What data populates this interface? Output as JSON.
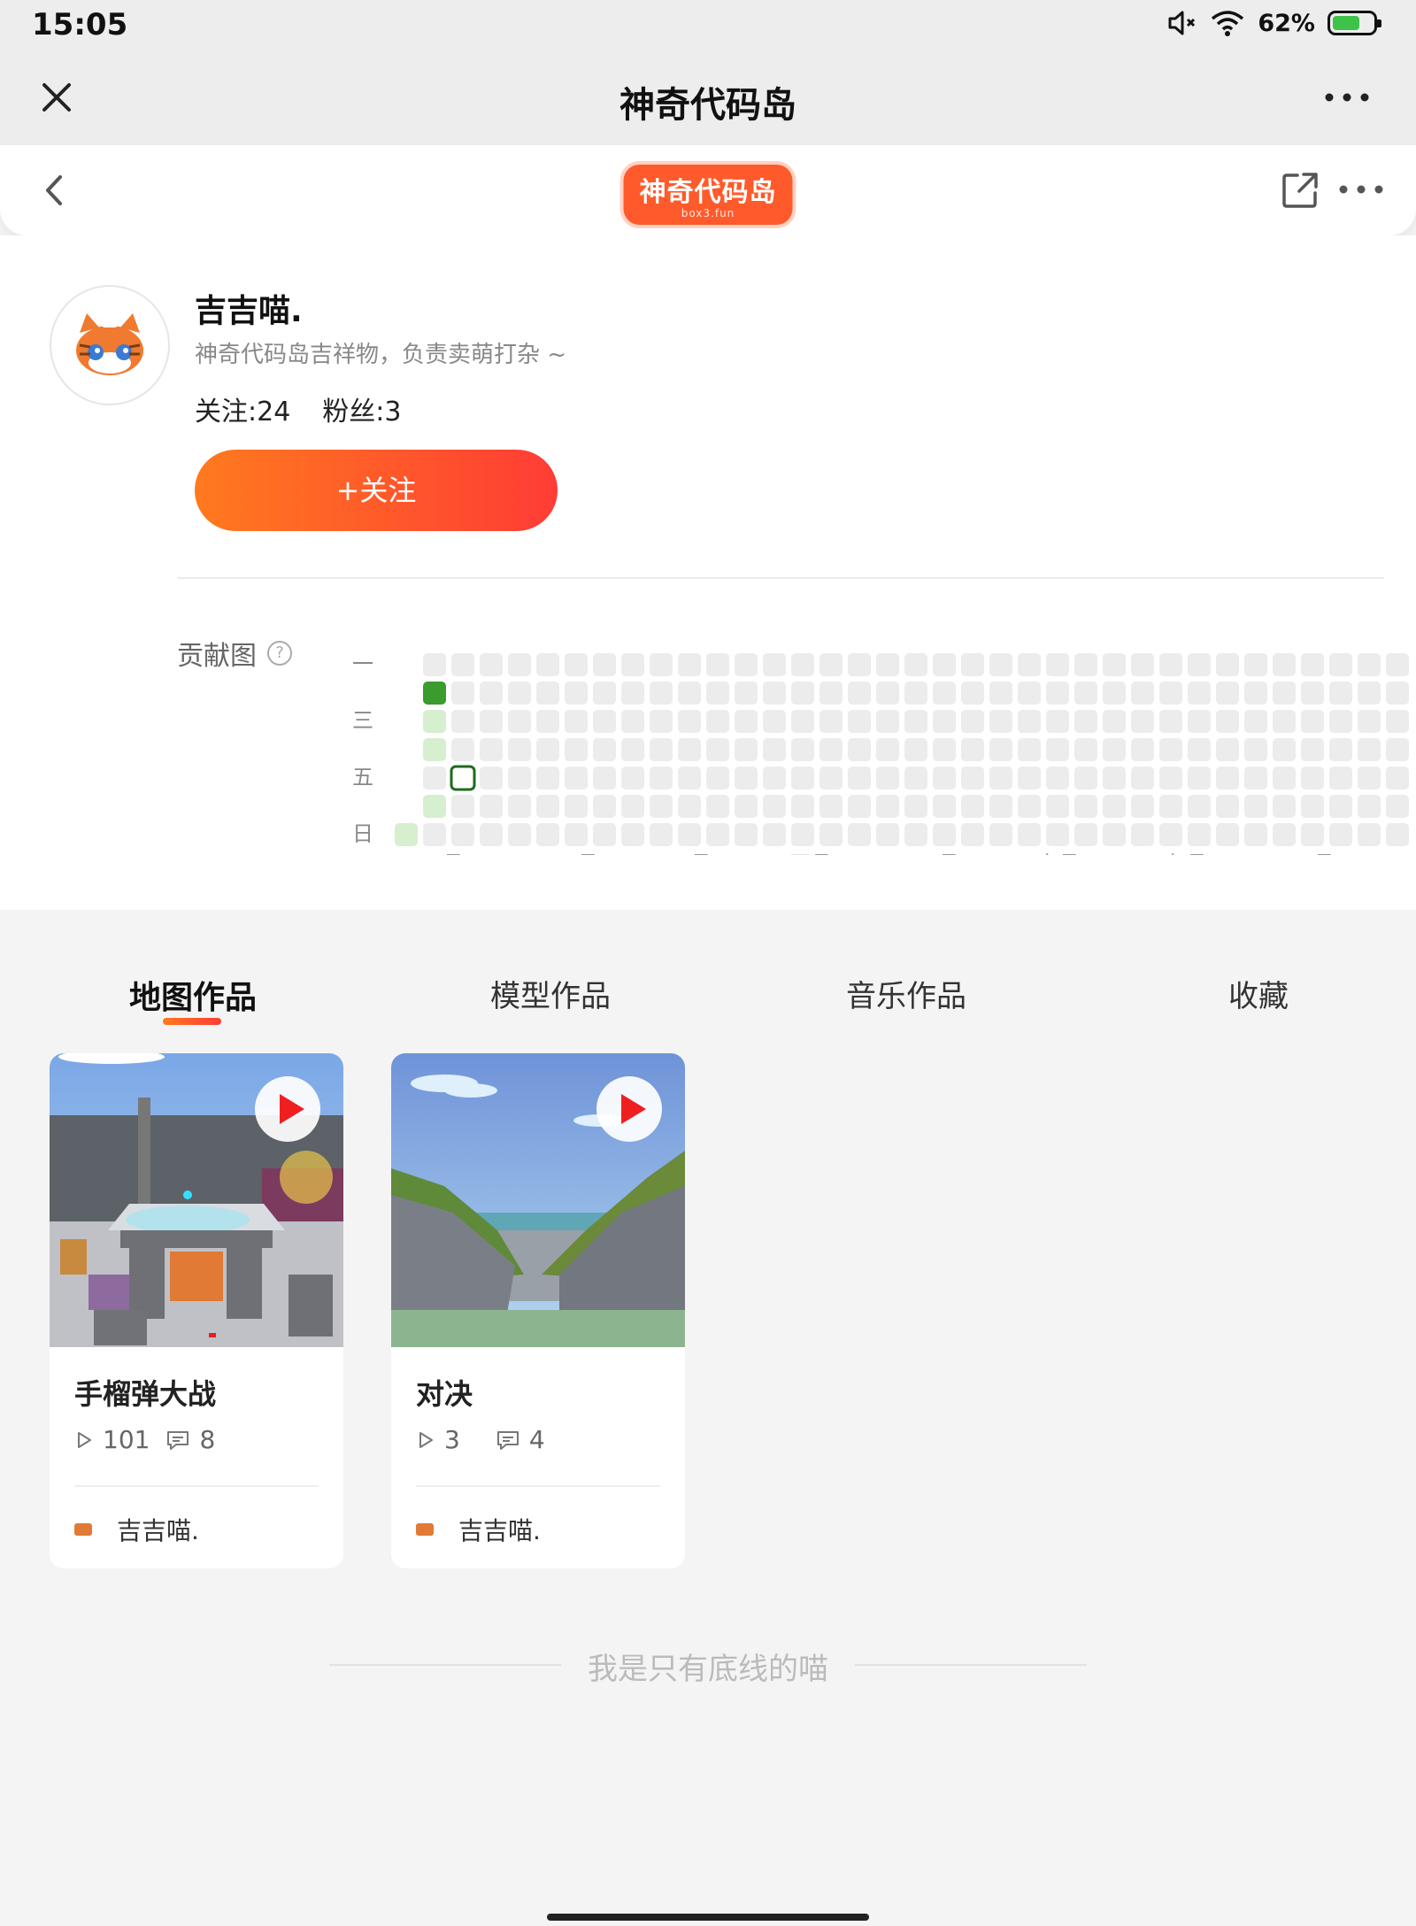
{
  "status": {
    "time": "15:05",
    "battery": "62%"
  },
  "app_bar": {
    "title": "神奇代码岛"
  },
  "site": {
    "logo_text": "神奇代码岛",
    "logo_sub": "box3.fun"
  },
  "profile": {
    "name": "吉吉喵.",
    "bio": "神奇代码岛吉祥物，负责卖萌打杂 ~",
    "following": "关注:24",
    "followers": "粉丝:3",
    "follow_label": "+关注"
  },
  "contribution": {
    "title": "贡献图",
    "help": "?",
    "weekday_labels": [
      "一",
      "",
      "三",
      "",
      "五",
      "",
      "日"
    ],
    "month_labels": [
      "一月",
      "二月",
      "三月",
      "四月",
      "五月",
      "六月",
      "七月",
      "八月"
    ],
    "colors": {
      "empty": "#ececec",
      "light": "#d6efcf",
      "dark": "#3a9b2e",
      "outline": "#1f6b1a"
    }
  },
  "tabs": [
    {
      "label": "地图作品",
      "active": true
    },
    {
      "label": "模型作品",
      "active": false
    },
    {
      "label": "音乐作品",
      "active": false
    },
    {
      "label": "收藏",
      "active": false
    }
  ],
  "works": [
    {
      "title": "手榴弹大战",
      "plays": "101",
      "comments": "8",
      "author": "吉吉喵."
    },
    {
      "title": "对决",
      "plays": "3",
      "comments": "4",
      "author": "吉吉喵."
    }
  ],
  "footer": {
    "text": "我是只有底线的喵"
  },
  "theme": {
    "accent_start": "#ff7a1e",
    "accent_end": "#ff3c35"
  }
}
